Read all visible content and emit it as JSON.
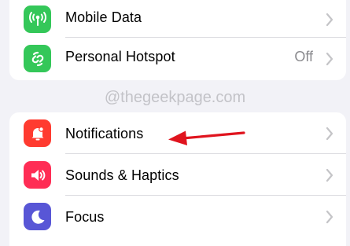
{
  "top_group": {
    "items": [
      {
        "label": "Mobile Data",
        "icon": "antenna-icon",
        "color": "#34c759"
      },
      {
        "label": "Personal Hotspot",
        "value": "Off",
        "icon": "hotspot-link-icon",
        "color": "#34c759"
      }
    ]
  },
  "watermark": "@thegeekpage.com",
  "bottom_group": {
    "items": [
      {
        "label": "Notifications",
        "icon": "bell-icon",
        "color": "#ff3b30"
      },
      {
        "label": "Sounds & Haptics",
        "icon": "speaker-icon",
        "color": "#ff2d55"
      },
      {
        "label": "Focus",
        "icon": "moon-icon",
        "color": "#5856d6"
      }
    ]
  },
  "annotation": {
    "arrow_color": "#e0141e",
    "points_to": "Notifications"
  }
}
